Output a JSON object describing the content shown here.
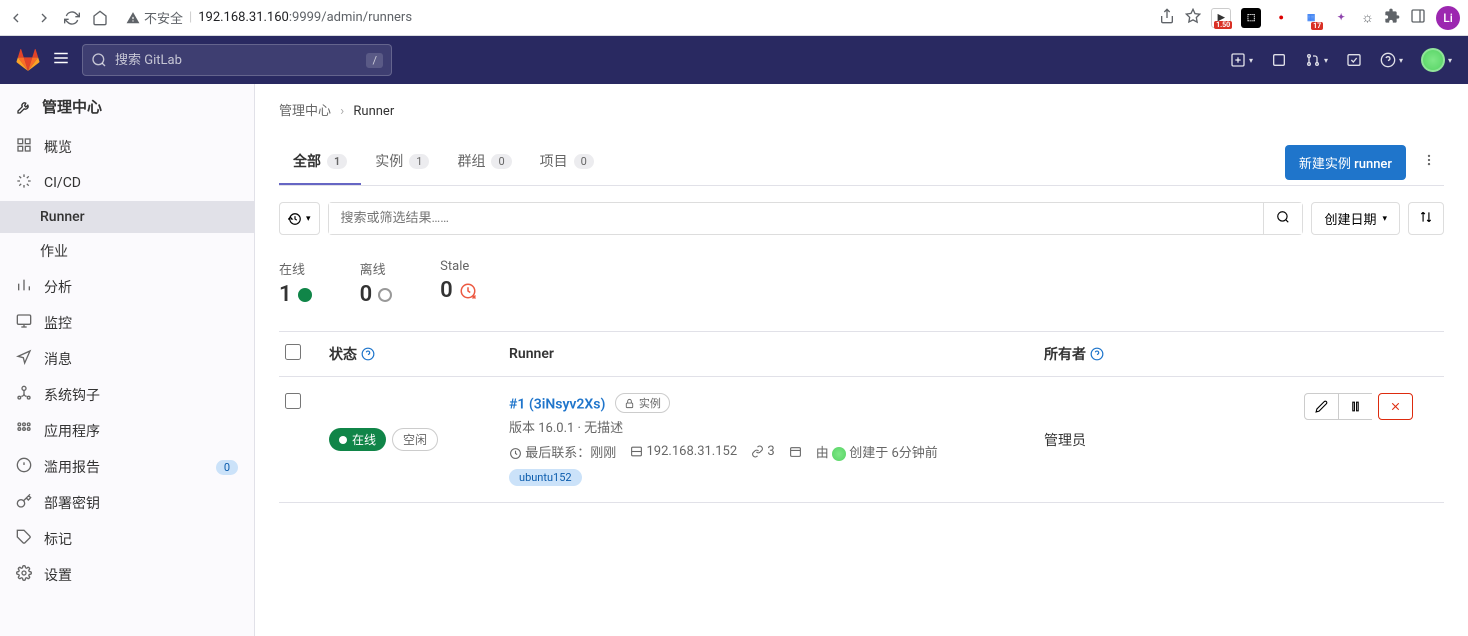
{
  "browser": {
    "url_prefix": "不安全",
    "url_host": "192.168.31.160",
    "url_port_path": ":9999/admin/runners",
    "avatar_letter": "Li",
    "ext_badge_1": "1.50",
    "ext_badge_2": "17"
  },
  "nav": {
    "search_placeholder": "搜索 GitLab",
    "slash": "/"
  },
  "sidebar": {
    "header": "管理中心",
    "items": [
      {
        "icon": "overview",
        "label": "概览"
      },
      {
        "icon": "cicd",
        "label": "CI/CD"
      },
      {
        "icon": "",
        "label": "Runner",
        "sub": true,
        "active": true
      },
      {
        "icon": "",
        "label": "作业",
        "sub": true
      },
      {
        "icon": "analytics",
        "label": "分析"
      },
      {
        "icon": "monitor",
        "label": "监控"
      },
      {
        "icon": "message",
        "label": "消息"
      },
      {
        "icon": "hooks",
        "label": "系统钩子"
      },
      {
        "icon": "apps",
        "label": "应用程序"
      },
      {
        "icon": "abuse",
        "label": "滥用报告",
        "badge": "0"
      },
      {
        "icon": "keys",
        "label": "部署密钥"
      },
      {
        "icon": "labels",
        "label": "标记"
      },
      {
        "icon": "settings",
        "label": "设置"
      }
    ]
  },
  "breadcrumb": {
    "root": "管理中心",
    "current": "Runner"
  },
  "tabs": [
    {
      "label": "全部",
      "count": "1",
      "active": true
    },
    {
      "label": "实例",
      "count": "1"
    },
    {
      "label": "群组",
      "count": "0"
    },
    {
      "label": "项目",
      "count": "0"
    }
  ],
  "new_runner_btn": "新建实例 runner",
  "filter_placeholder": "搜索或筛选结果……",
  "sort_label": "创建日期",
  "stats": {
    "online_label": "在线",
    "online_count": "1",
    "offline_label": "离线",
    "offline_count": "0",
    "stale_label": "Stale",
    "stale_count": "0"
  },
  "table_header": {
    "status": "状态",
    "runner": "Runner",
    "owner": "所有者"
  },
  "runner": {
    "status_online": "在线",
    "status_idle": "空闲",
    "id_link": "#1 (3iNsyv2Xs)",
    "type_badge": "实例",
    "version_line": "版本 16.0.1 · 无描述",
    "last_contact_label": "最后联系：",
    "last_contact_value": "刚刚",
    "ip": "192.168.31.152",
    "jobs": "3",
    "created_by_prefix": "由",
    "created_label": "创建于",
    "created_value": "6分钟前",
    "tag": "ubuntu152",
    "owner": "管理员"
  }
}
